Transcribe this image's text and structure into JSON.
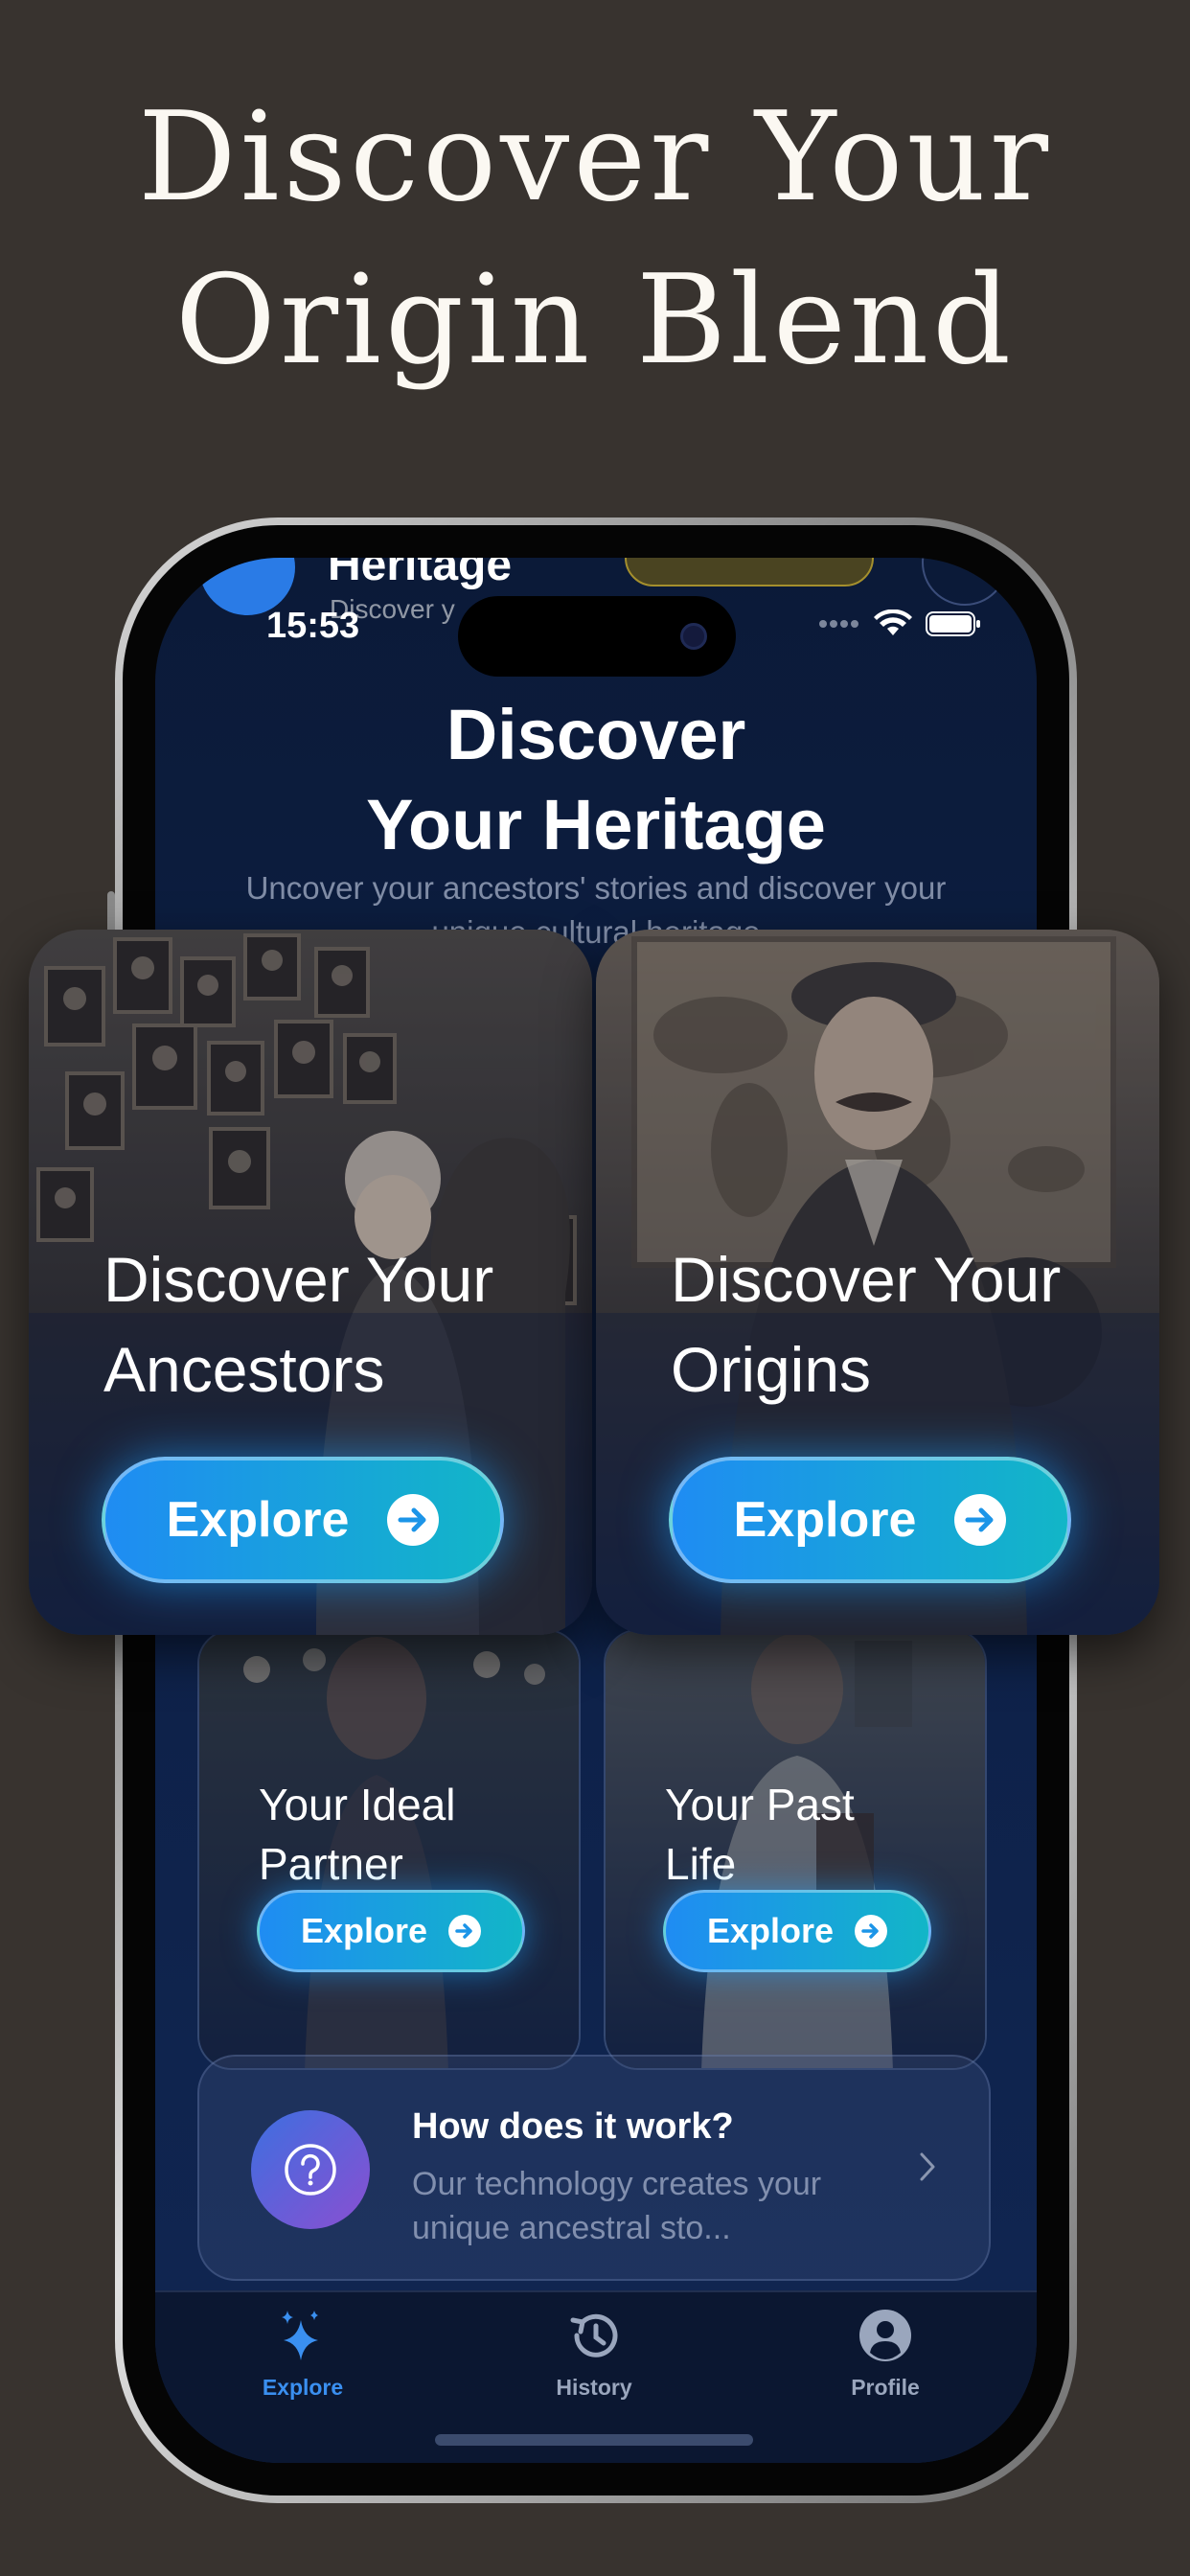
{
  "promo": {
    "line1": "Discover Your",
    "line2": "Origin Blend"
  },
  "status_bar": {
    "time": "15:53"
  },
  "app_header": {
    "title": "Heritage",
    "subtitle": "Discover y"
  },
  "hero": {
    "title_line1": "Discover",
    "title_line2": "Your Heritage",
    "subtitle": "Uncover your ancestors' stories and discover your unique cultural heritage"
  },
  "feature_cards": [
    {
      "line1": "Discover Your",
      "line2": "Ancestors",
      "button": "Explore"
    },
    {
      "line1": "Discover Your",
      "line2": "Origins",
      "button": "Explore"
    }
  ],
  "small_cards": [
    {
      "line1": "Your Ideal",
      "line2": "Partner",
      "button": "Explore"
    },
    {
      "line1": "Your Past",
      "line2": "Life",
      "button": "Explore"
    }
  ],
  "how_it_works": {
    "title": "How does it work?",
    "description": "Our technology creates your unique ancestral sto..."
  },
  "tabs": [
    {
      "label": "Explore",
      "icon": "sparkles-icon",
      "active": true
    },
    {
      "label": "History",
      "icon": "history-clock-icon",
      "active": false
    },
    {
      "label": "Profile",
      "icon": "person-circle-icon",
      "active": false
    }
  ],
  "colors": {
    "background": "#38332f",
    "screen": "#0e2148",
    "accent": "#1f8cf3",
    "accent_end": "#12b6c7",
    "tab_active": "#3a8ff0",
    "tab_inactive": "#9aa6bd"
  }
}
